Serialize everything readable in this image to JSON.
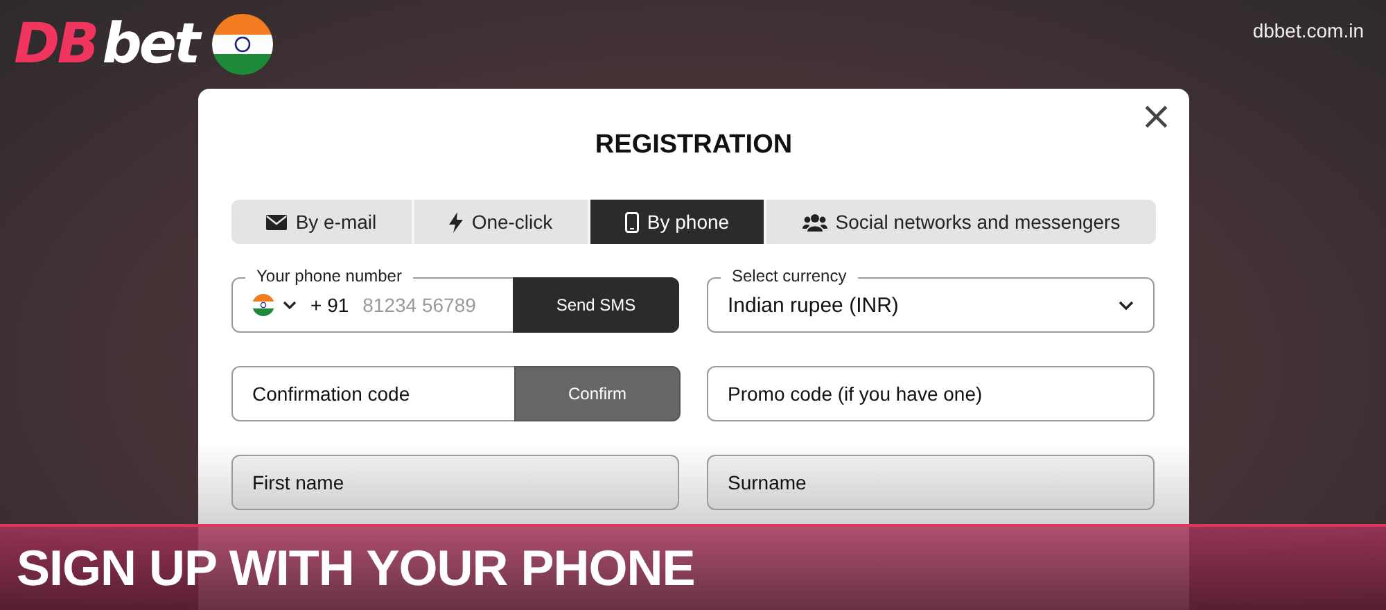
{
  "logo": {
    "part_1": "DB",
    "part_2": "bet"
  },
  "site": "dbbet.com.in",
  "dialog": {
    "title": "REGISTRATION",
    "close": "×"
  },
  "tabs": [
    {
      "label": "By e-mail",
      "selected": false
    },
    {
      "label": "One-click",
      "selected": false
    },
    {
      "label": "By phone",
      "selected": true
    },
    {
      "label": "Social networks and messengers",
      "selected": false
    }
  ],
  "phone": {
    "label": "Your phone number",
    "code": "+ 91",
    "placeholder": "81234 56789",
    "button": "Send SMS"
  },
  "currency": {
    "label": "Select currency",
    "value": "Indian rupee (INR)"
  },
  "confirmation": {
    "placeholder": "Confirmation code",
    "button": "Confirm"
  },
  "fields": [
    {
      "placeholder": "Promo code (if you have one)"
    },
    {
      "placeholder": "First name"
    },
    {
      "placeholder": "Surname"
    }
  ],
  "banner": "SIGN UP WITH YOUR PHONE"
}
